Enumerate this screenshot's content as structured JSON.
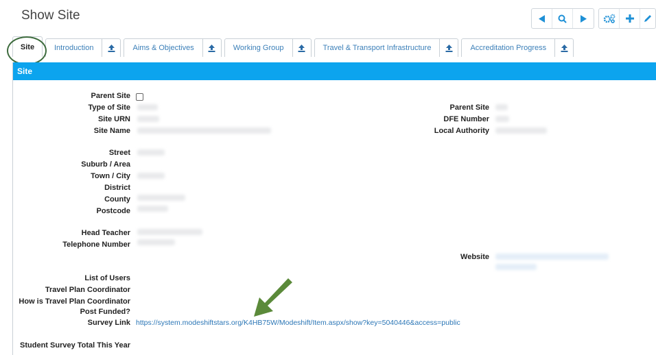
{
  "page": {
    "title": "Show Site"
  },
  "toolbar": {
    "prev": "previous-icon",
    "search": "search-icon",
    "next": "next-icon",
    "settings": "gears-icon",
    "add": "plus-icon",
    "edit": "pencil-icon"
  },
  "tabs": [
    {
      "label": "Site",
      "active": true
    },
    {
      "label": "Introduction"
    },
    {
      "label": "Aims & Objectives"
    },
    {
      "label": "Working Group"
    },
    {
      "label": "Travel & Transport Infrastructure"
    },
    {
      "label": "Accreditation Progress"
    }
  ],
  "panel": {
    "header": "Site"
  },
  "fields": {
    "parent_site_check": "Parent Site",
    "type_of_site": "Type of Site",
    "site_urn": "Site URN",
    "site_name": "Site Name",
    "street": "Street",
    "suburb": "Suburb / Area",
    "town": "Town / City",
    "district": "District",
    "county": "County",
    "postcode": "Postcode",
    "head_teacher": "Head Teacher",
    "telephone": "Telephone Number",
    "list_of_users": "List of Users",
    "tpc": "Travel Plan Coordinator",
    "tpc_post_funded_1": "How is Travel Plan Coordinator",
    "tpc_post_funded_2": "Post Funded?",
    "survey_link": "Survey Link",
    "student_survey": "Student Survey Total This Year",
    "parent_site": "Parent Site",
    "dfe_number": "DFE Number",
    "local_authority": "Local Authority",
    "website": "Website"
  },
  "survey_link_value": "https://system.modeshiftstars.org/K4HB75W/Modeshift/Item.aspx/show?key=5040446&access=public",
  "colors": {
    "header_blue": "#0ca4ee",
    "link_blue": "#2b76b6",
    "annotation_green": "#5b8a3a"
  }
}
